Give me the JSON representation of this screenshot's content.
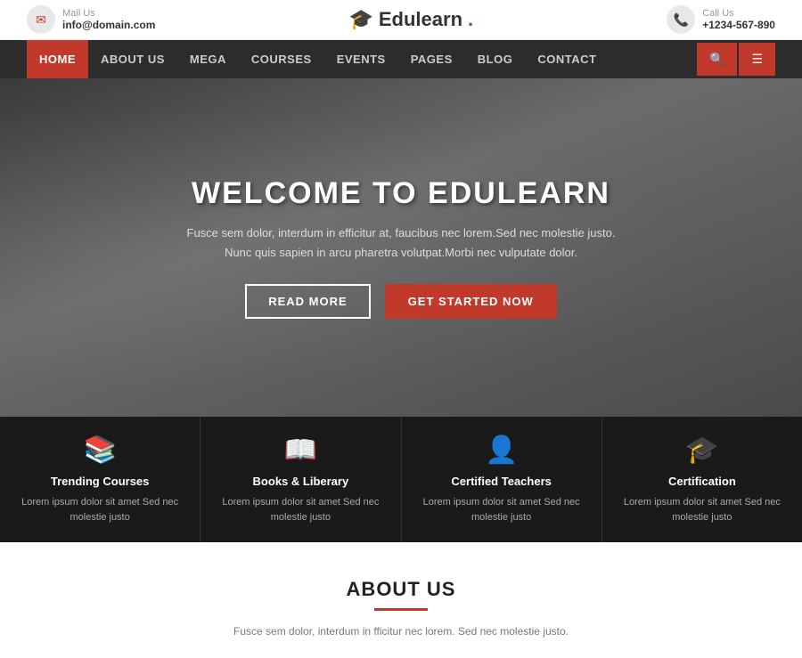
{
  "topbar": {
    "mail_label": "Mail Us",
    "mail_value": "info@domain.com",
    "logo_text": "Edulearn",
    "logo_dot": ".",
    "call_label": "Call Us",
    "call_value": "+1234-567-890"
  },
  "nav": {
    "items": [
      {
        "label": "HOME",
        "active": true
      },
      {
        "label": "ABOUT US",
        "active": false
      },
      {
        "label": "MEGA",
        "active": false
      },
      {
        "label": "COURSES",
        "active": false
      },
      {
        "label": "EVENTS",
        "active": false
      },
      {
        "label": "PAGES",
        "active": false
      },
      {
        "label": "BLOG",
        "active": false
      },
      {
        "label": "CONTACT",
        "active": false
      }
    ],
    "search_btn": "🔍",
    "menu_btn": "☰"
  },
  "hero": {
    "title": "WELCOME TO EDULEARN",
    "subtitle_line1": "Fusce sem dolor, interdum in efficitur at, faucibus nec lorem.Sed nec molestie justo.",
    "subtitle_line2": "Nunc quis sapien in arcu pharetra volutpat.Morbi nec vulputate dolor.",
    "btn_read_more": "READ MORE",
    "btn_get_started": "GET STARTED NOW"
  },
  "features": [
    {
      "icon": "📚",
      "title": "Trending Courses",
      "text": "Lorem ipsum dolor sit amet Sed nec molestie justo"
    },
    {
      "icon": "📖",
      "title": "Books & Liberary",
      "text": "Lorem ipsum dolor sit amet Sed nec molestie justo"
    },
    {
      "icon": "👤",
      "title": "Certified Teachers",
      "text": "Lorem ipsum dolor sit amet Sed nec molestie justo"
    },
    {
      "icon": "🎓",
      "title": "Certification",
      "text": "Lorem ipsum dolor sit amet Sed nec molestie justo"
    }
  ],
  "about": {
    "title": "ABOUT US",
    "text": "Fusce sem dolor, interdum in fficitur nec lorem. Sed nec molestie justo."
  }
}
